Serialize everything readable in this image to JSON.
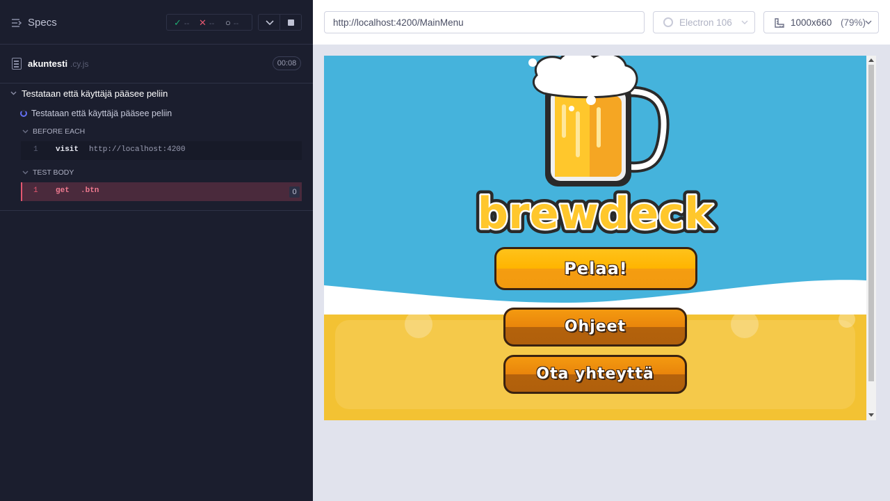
{
  "reporter": {
    "header": {
      "title": "Specs",
      "passed": "--",
      "failed": "--",
      "pending": "--"
    },
    "spec": {
      "name": "akuntesti",
      "ext": ".cy.js",
      "duration": "00:08"
    },
    "suite": {
      "title": "Testataan että käyttäjä pääsee peliin"
    },
    "test": {
      "title": "Testataan että käyttäjä pääsee peliin"
    },
    "hooks": [
      {
        "title": "BEFORE EACH",
        "commands": [
          {
            "num": "1",
            "name": "visit",
            "message": "http://localhost:4200"
          }
        ]
      },
      {
        "title": "TEST BODY",
        "commands": [
          {
            "num": "1",
            "name": "get",
            "message": ".btn",
            "count": "0"
          }
        ]
      }
    ]
  },
  "topbar": {
    "url": "http://localhost:4200/MainMenu",
    "browser": "Electron 106",
    "viewport": "1000x660",
    "zoom": "(79%)"
  },
  "app": {
    "logo_text": "brewdeck",
    "buttons": {
      "play": "Pelaa!",
      "help": "Ohjeet",
      "contact": "Ota yhteyttä"
    }
  },
  "colors": {
    "reporter_bg": "#1b1e2e",
    "sky": "#45b3dc",
    "beer": "#f3c233",
    "fail": "#e45770",
    "pass": "#1fa971",
    "accent": "#6470f3"
  }
}
